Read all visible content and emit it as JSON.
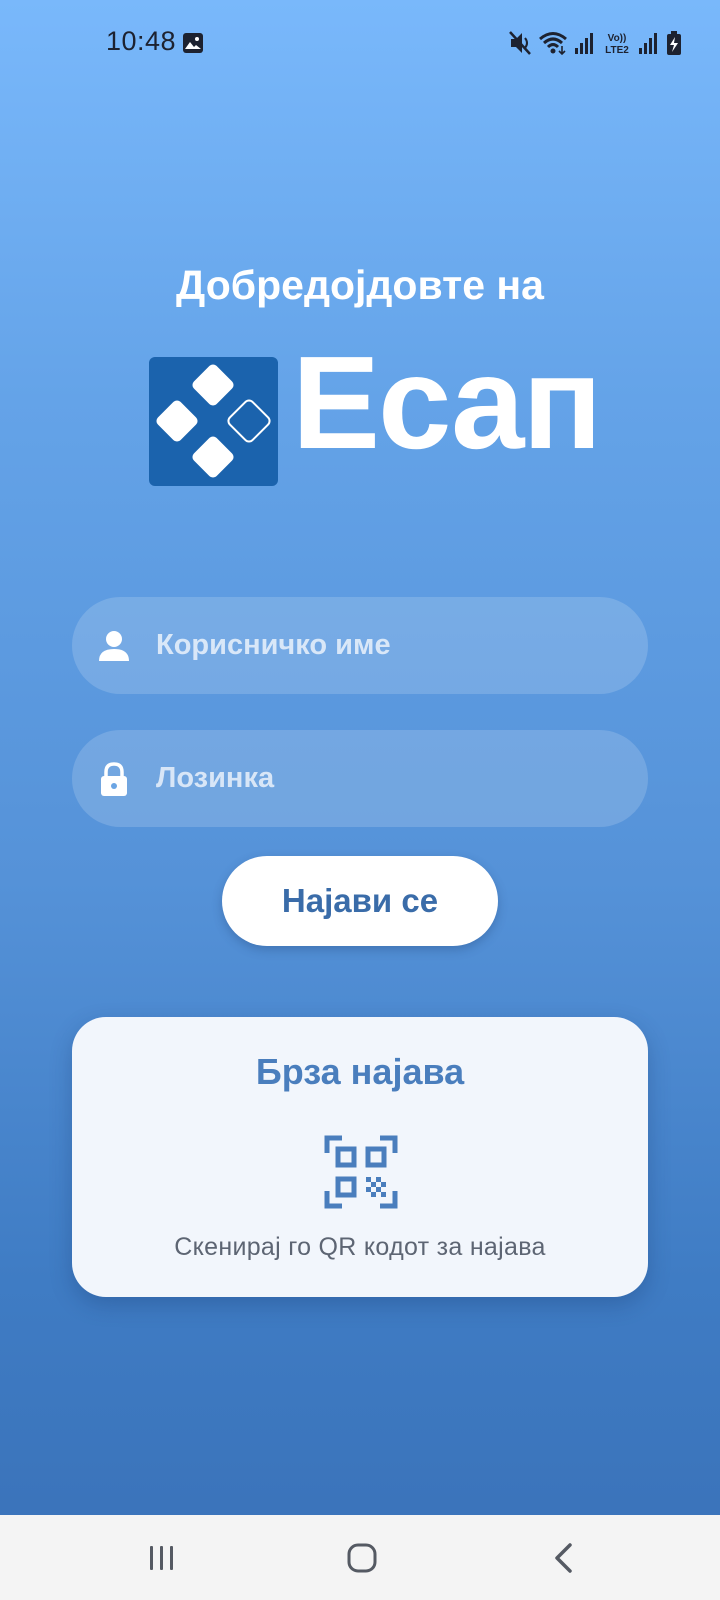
{
  "status_bar": {
    "time": "10:48",
    "icons": [
      "gallery-icon",
      "mute-icon",
      "wifi-icon",
      "signal-icon",
      "volte-lte2-icon",
      "signal-2-icon",
      "battery-charging-icon"
    ],
    "volte_label": "Vo)) LTE2"
  },
  "welcome": {
    "title": "Добредојдовте на"
  },
  "logo": {
    "text": "Есап",
    "box_color": "#1b63ad"
  },
  "form": {
    "username": {
      "placeholder": "Корисничко име",
      "value": "",
      "icon": "person-icon"
    },
    "password": {
      "placeholder": "Лозинка",
      "value": "",
      "icon": "lock-icon"
    },
    "login_label": "Најави се"
  },
  "quick_login": {
    "title": "Брза најава",
    "icon": "qr-code-icon",
    "subtitle": "Скенирај го QR кодот за најава"
  },
  "nav_bar": {
    "buttons": [
      "recent-apps-icon",
      "home-icon",
      "back-icon"
    ]
  },
  "colors": {
    "accent": "#4a7ebd",
    "button_text": "#3a6ca9",
    "gradient_top": "#79b8fb",
    "gradient_bottom": "#3b74bb"
  }
}
